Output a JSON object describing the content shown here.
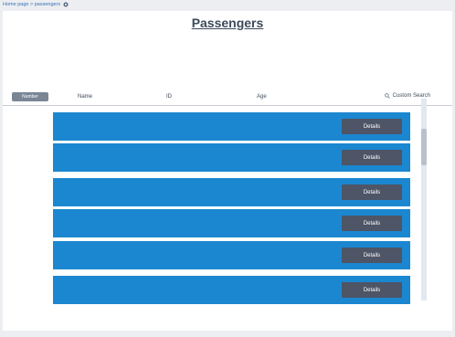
{
  "breadcrumb": {
    "text": "Home page > passengers",
    "icon": "gear-icon"
  },
  "page": {
    "title": "Passengers"
  },
  "table": {
    "number_button": "Number",
    "columns": {
      "name": "Name",
      "id": "ID",
      "age": "Age"
    },
    "search_label": "Custom Search",
    "rows": [
      {
        "details_label": "Details"
      },
      {
        "details_label": "Details"
      },
      {
        "details_label": "Details"
      },
      {
        "details_label": "Details"
      },
      {
        "details_label": "Details"
      },
      {
        "details_label": "Details"
      }
    ]
  },
  "colors": {
    "row": "#1b87d0",
    "button": "#4d5566",
    "accent": "#3a73b8"
  }
}
